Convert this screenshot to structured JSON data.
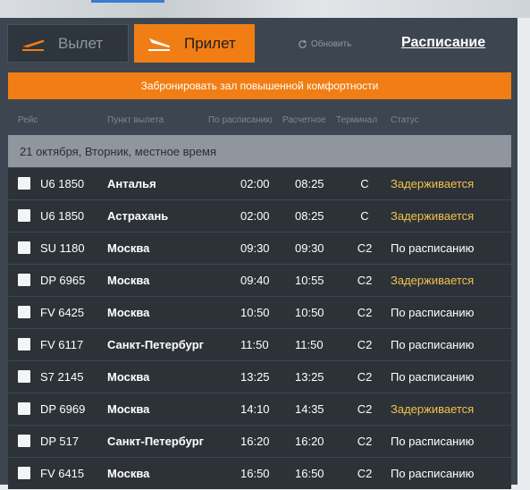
{
  "header": {
    "tab_departure": "Вылет",
    "tab_arrival": "Прилет",
    "refresh_label": "Обновить",
    "schedule_link": "Расписание"
  },
  "banner": {
    "text": "Забронировать зал повышенной комфортности"
  },
  "columns": {
    "flight": "Рейс",
    "origin": "Пункт вылета",
    "scheduled": "По расписанию",
    "estimated": "Расчетное",
    "terminal": "Терминал",
    "status": "Статус"
  },
  "date_label": "21 октября, Вторник, местное время",
  "flights": [
    {
      "flight": "U6 1850",
      "city": "Анталья",
      "scheduled": "02:00",
      "estimated": "08:25",
      "terminal": "C",
      "status": "Задерживается",
      "delayed": true
    },
    {
      "flight": "U6 1850",
      "city": "Астрахань",
      "scheduled": "02:00",
      "estimated": "08:25",
      "terminal": "C",
      "status": "Задерживается",
      "delayed": true
    },
    {
      "flight": "SU 1180",
      "city": "Москва",
      "scheduled": "09:30",
      "estimated": "09:30",
      "terminal": "C2",
      "status": "По расписанию",
      "delayed": false
    },
    {
      "flight": "DP 6965",
      "city": "Москва",
      "scheduled": "09:40",
      "estimated": "10:55",
      "terminal": "C2",
      "status": "Задерживается",
      "delayed": true
    },
    {
      "flight": "FV 6425",
      "city": "Москва",
      "scheduled": "10:50",
      "estimated": "10:50",
      "terminal": "C2",
      "status": "По расписанию",
      "delayed": false
    },
    {
      "flight": "FV 6117",
      "city": "Санкт-Петербург",
      "scheduled": "11:50",
      "estimated": "11:50",
      "terminal": "C2",
      "status": "По расписанию",
      "delayed": false
    },
    {
      "flight": "S7 2145",
      "city": "Москва",
      "scheduled": "13:25",
      "estimated": "13:25",
      "terminal": "C2",
      "status": "По расписанию",
      "delayed": false
    },
    {
      "flight": "DP 6969",
      "city": "Москва",
      "scheduled": "14:10",
      "estimated": "14:35",
      "terminal": "C2",
      "status": "Задерживается",
      "delayed": true
    },
    {
      "flight": "DP 517",
      "city": "Санкт-Петербург",
      "scheduled": "16:20",
      "estimated": "16:20",
      "terminal": "C2",
      "status": "По расписанию",
      "delayed": false
    },
    {
      "flight": "FV 6415",
      "city": "Москва",
      "scheduled": "16:50",
      "estimated": "16:50",
      "terminal": "C2",
      "status": "По расписанию",
      "delayed": false
    }
  ],
  "colors": {
    "accent": "#f07e14",
    "delayed": "#f4c24c",
    "board": "#3d4650",
    "row": "#2c3238"
  }
}
